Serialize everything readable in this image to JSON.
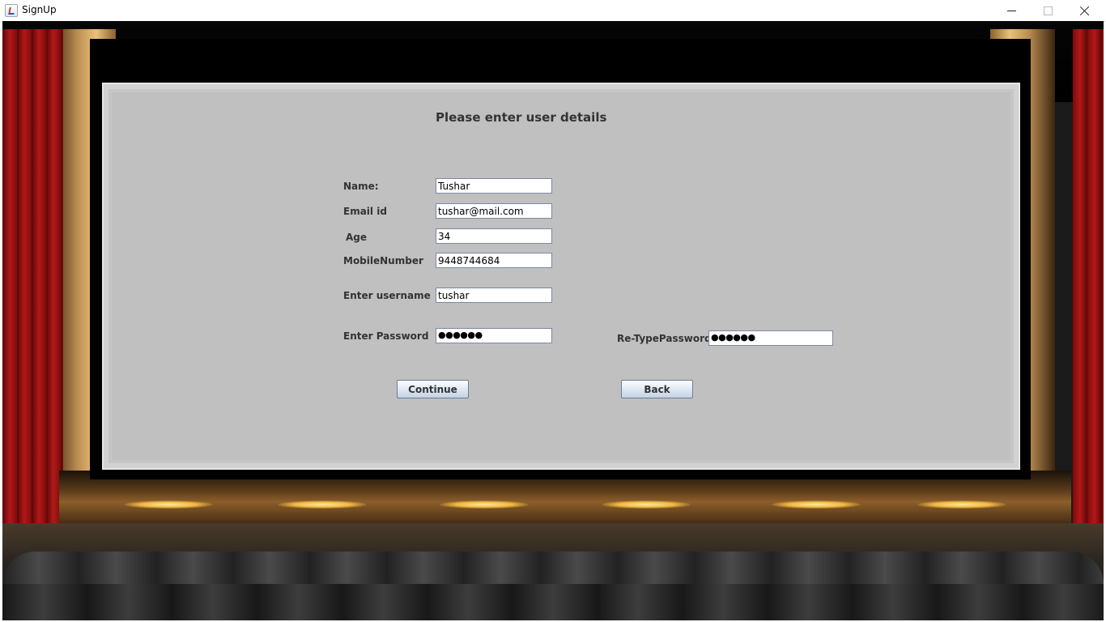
{
  "window": {
    "title": "SignUp",
    "controls": {
      "minimize_icon": "minimize-icon",
      "maximize_icon": "maximize-icon",
      "close_icon": "close-icon"
    }
  },
  "form": {
    "heading": "Please enter user details",
    "fields": {
      "name": {
        "label": "Name:",
        "value": "Tushar"
      },
      "email": {
        "label": "Email id",
        "value": "tushar@mail.com"
      },
      "age": {
        "label": "Age",
        "value": "34"
      },
      "mobile": {
        "label": "MobileNumber",
        "value": "9448744684"
      },
      "username": {
        "label": "Enter username",
        "value": "tushar"
      },
      "password": {
        "label": "Enter Password",
        "value": "●●●●●●"
      },
      "retype_password": {
        "label": "Re-TypePassword",
        "value": "●●●●●●"
      }
    },
    "buttons": {
      "continue": "Continue",
      "back": "Back"
    }
  },
  "colors": {
    "panel": "#c0c0c0",
    "curtain": "#b31818",
    "button_border": "#6a7d9a"
  }
}
